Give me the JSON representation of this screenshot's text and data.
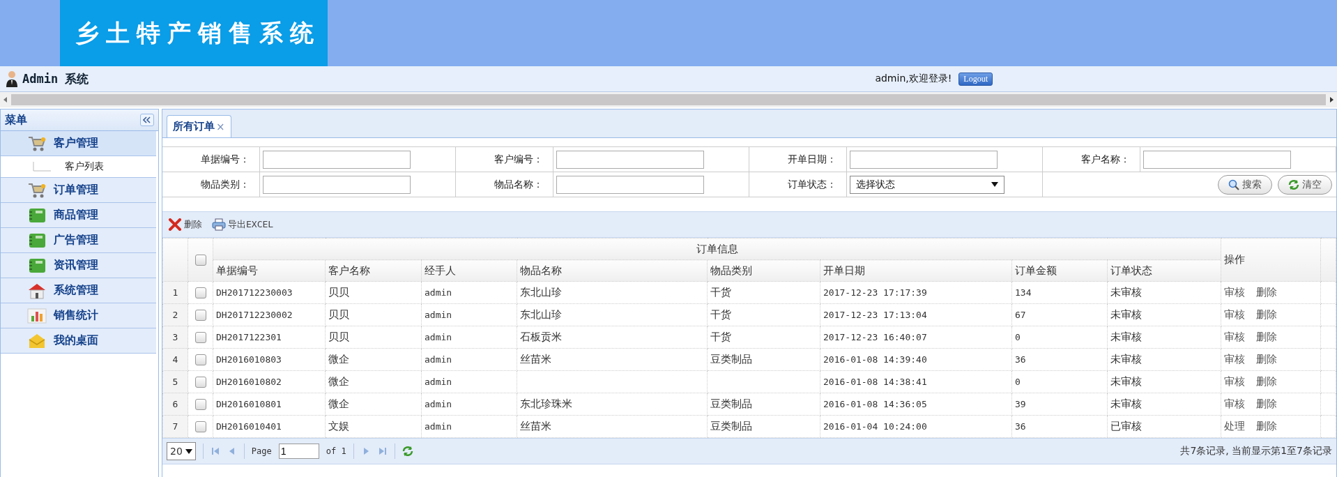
{
  "header": {
    "logo": "乡土特产销售系统"
  },
  "userbar": {
    "title": "Admin 系统",
    "greeting": "admin,欢迎登录!",
    "logout": "Logout"
  },
  "sidebar": {
    "title": "菜单",
    "items": [
      {
        "label": "客户管理",
        "kind": "cart",
        "expanded": true,
        "children": [
          {
            "label": "客户列表"
          }
        ]
      },
      {
        "label": "订单管理",
        "kind": "cart",
        "expanded": false
      },
      {
        "label": "商品管理",
        "kind": "book",
        "expanded": false
      },
      {
        "label": "广告管理",
        "kind": "book",
        "expanded": false
      },
      {
        "label": "资讯管理",
        "kind": "book",
        "expanded": false
      },
      {
        "label": "系统管理",
        "kind": "house",
        "expanded": false
      },
      {
        "label": "销售统计",
        "kind": "chart",
        "expanded": false
      },
      {
        "label": "我的桌面",
        "kind": "mail",
        "expanded": false
      }
    ]
  },
  "tabs": [
    {
      "label": "所有订单",
      "close": "×",
      "selected": true
    }
  ],
  "filters": [
    {
      "label": "单据编号：",
      "kind": "text"
    },
    {
      "label": "客户编号：",
      "kind": "text"
    },
    {
      "label": "开单日期：",
      "kind": "text"
    },
    {
      "label": "客户名称：",
      "kind": "text"
    },
    {
      "label": "物品类别：",
      "kind": "text"
    },
    {
      "label": "物品名称：",
      "kind": "text"
    },
    {
      "label": "订单状态：",
      "kind": "select",
      "value": "选择状态"
    }
  ],
  "filter_buttons": [
    {
      "label": "搜索",
      "kind": "search"
    },
    {
      "label": "清空",
      "kind": "clear"
    }
  ],
  "toolbar": [
    {
      "label": "删除",
      "kind": "delete"
    },
    {
      "label": "导出EXCEL",
      "kind": "export"
    }
  ],
  "table": {
    "group_header": "订单信息",
    "action_header": "操作",
    "all_checked": false,
    "columns": [
      "单据编号",
      "客户名称",
      "经手人",
      "物品名称",
      "物品类别",
      "开单日期",
      "订单金额",
      "订单状态"
    ],
    "rows": [
      {
        "num": "1",
        "checked": false,
        "cells": [
          "DH201712230003",
          "贝贝",
          "admin",
          "东北山珍",
          "干货",
          "2017-12-23 17:17:39",
          "134",
          "未审核"
        ],
        "actions": [
          "审核",
          "删除"
        ]
      },
      {
        "num": "2",
        "checked": false,
        "cells": [
          "DH201712230002",
          "贝贝",
          "admin",
          "东北山珍",
          "干货",
          "2017-12-23 17:13:04",
          "67",
          "未审核"
        ],
        "actions": [
          "审核",
          "删除"
        ]
      },
      {
        "num": "3",
        "checked": false,
        "cells": [
          "DH2017122301",
          "贝贝",
          "admin",
          "石板贡米",
          "干货",
          "2017-12-23 16:40:07",
          "0",
          "未审核"
        ],
        "actions": [
          "审核",
          "删除"
        ]
      },
      {
        "num": "4",
        "checked": false,
        "cells": [
          "DH2016010803",
          "微企",
          "admin",
          "丝苗米",
          "豆类制品",
          "2016-01-08 14:39:40",
          "36",
          "未审核"
        ],
        "actions": [
          "审核",
          "删除"
        ]
      },
      {
        "num": "5",
        "checked": false,
        "cells": [
          "DH2016010802",
          "微企",
          "admin",
          "",
          "",
          "2016-01-08 14:38:41",
          "0",
          "未审核"
        ],
        "actions": [
          "审核",
          "删除"
        ]
      },
      {
        "num": "6",
        "checked": false,
        "cells": [
          "DH2016010801",
          "微企",
          "admin",
          "东北珍珠米",
          "豆类制品",
          "2016-01-08 14:36:05",
          "39",
          "未审核"
        ],
        "actions": [
          "审核",
          "删除"
        ]
      },
      {
        "num": "7",
        "checked": false,
        "cells": [
          "DH2016010401",
          "文娱",
          "admin",
          "丝苗米",
          "豆类制品",
          "2016-01-04 10:24:00",
          "36",
          "已审核"
        ],
        "actions": [
          "处理",
          "删除"
        ]
      }
    ]
  },
  "pager": {
    "page_size": "20",
    "page_label": "Page",
    "page": "1",
    "of": "of 1",
    "summary": "共7条记录, 当前显示第1至7条记录"
  }
}
